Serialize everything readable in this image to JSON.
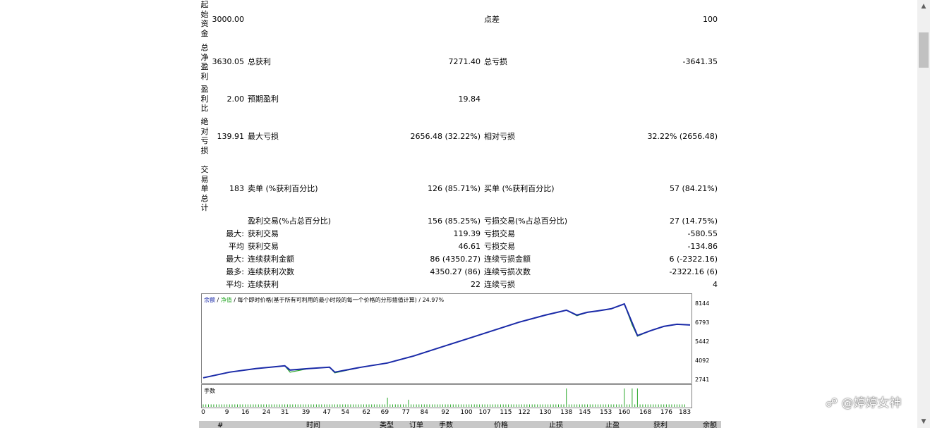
{
  "summary": {
    "initial_deposit_label": "起始资金",
    "initial_deposit": "3000.00",
    "spread_label": "点差",
    "spread": "100",
    "net_profit_label": "总净盈利",
    "net_profit": "3630.05",
    "gross_profit_label": "总获利",
    "gross_profit": "7271.40",
    "gross_loss_label": "总亏损",
    "gross_loss": "-3641.35",
    "profit_factor_label": "盈利比",
    "profit_factor": "2.00",
    "expected_payoff_label": "预期盈利",
    "expected_payoff": "19.84",
    "abs_drawdown_label": "绝对亏损",
    "abs_drawdown": "139.91",
    "max_drawdown_label": "最大亏损",
    "max_drawdown": "2656.48 (32.22%)",
    "rel_drawdown_label": "相对亏损",
    "rel_drawdown": "32.22% (2656.48)",
    "total_trades_label": "交易单总计",
    "total_trades": "183",
    "short_label": "卖单 (%获利百分比)",
    "short_value": "126 (85.71%)",
    "long_label": "买单 (%获利百分比)",
    "long_value": "57 (84.21%)"
  },
  "rows": [
    {
      "prefix": "",
      "label1": "盈利交易(%占总百分比)",
      "value1": "156 (85.25%)",
      "label2": "亏损交易(%占总百分比)",
      "value2": "27 (14.75%)"
    },
    {
      "prefix": "最大:",
      "label1": "获利交易",
      "value1": "119.39",
      "label2": "亏损交易",
      "value2": "-580.55"
    },
    {
      "prefix": "平均",
      "label1": "获利交易",
      "value1": "46.61",
      "label2": "亏损交易",
      "value2": "-134.86"
    },
    {
      "prefix": "最大:",
      "label1": "连续获利金额",
      "value1": "86 (4350.27)",
      "label2": "连续亏损金额",
      "value2": "6 (-2322.16)"
    },
    {
      "prefix": "最多:",
      "label1": "连续获利次数",
      "value1": "4350.27 (86)",
      "label2": "连续亏损次数",
      "value2": "-2322.16 (6)"
    },
    {
      "prefix": "平均:",
      "label1": "连续获利",
      "value1": "22",
      "label2": "连续亏损",
      "value2": "4"
    }
  ],
  "chart": {
    "legend_balance": "余额",
    "legend_sep1": " / ",
    "legend_equity": "净值",
    "legend_rest": " / 每个即时价格(基于所有可利用的最小时段的每一个价格的分形插值计算) / 24.97%",
    "volume_label": "手数",
    "balance_color": "#1a2aa8",
    "equity_color": "#2aa82a",
    "volume_color": "#2aa82a",
    "y_ticks": [
      "8144",
      "6793",
      "5442",
      "4092",
      "2741"
    ],
    "x_ticks": [
      "0",
      "9",
      "16",
      "24",
      "31",
      "39",
      "47",
      "54",
      "62",
      "69",
      "77",
      "84",
      "92",
      "100",
      "107",
      "115",
      "122",
      "130",
      "138",
      "145",
      "153",
      "160",
      "168",
      "176",
      "183"
    ]
  },
  "chart_data": {
    "type": "line",
    "title": "",
    "xlabel": "",
    "ylabel": "",
    "ylim": [
      2741,
      8144
    ],
    "xlim": [
      0,
      185
    ],
    "series": [
      {
        "name": "余额",
        "x": [
          0,
          10,
          20,
          31,
          33,
          40,
          48,
          50,
          60,
          70,
          80,
          90,
          100,
          110,
          120,
          130,
          138,
          142,
          146,
          150,
          155,
          160,
          165,
          170,
          175,
          180,
          185
        ],
        "y": [
          2900,
          3300,
          3550,
          3750,
          3450,
          3550,
          3650,
          3300,
          3650,
          3950,
          4450,
          5050,
          5650,
          6250,
          6850,
          7350,
          7700,
          7350,
          7550,
          7650,
          7800,
          8144,
          5900,
          6250,
          6550,
          6700,
          6650
        ]
      },
      {
        "name": "净值",
        "x": [
          0,
          10,
          20,
          31,
          33,
          40,
          48,
          50,
          60,
          70,
          80,
          90,
          100,
          110,
          120,
          130,
          138,
          142,
          146,
          150,
          155,
          160,
          163,
          165,
          170,
          175,
          180,
          185
        ],
        "y": [
          2900,
          3300,
          3550,
          3750,
          3300,
          3550,
          3650,
          3250,
          3650,
          3950,
          4450,
          5050,
          5650,
          6250,
          6850,
          7350,
          7700,
          7300,
          7550,
          7650,
          7800,
          8144,
          6650,
          5850,
          6250,
          6550,
          6700,
          6650
        ]
      }
    ],
    "volume": {
      "name": "手数",
      "normal": 0.12,
      "spikes": [
        [
          70,
          0.45
        ],
        [
          78,
          0.35
        ],
        [
          138,
          0.9
        ],
        [
          160,
          0.9
        ],
        [
          163,
          0.9
        ],
        [
          165,
          0.9
        ]
      ]
    },
    "x_ticks": [
      0,
      9,
      16,
      24,
      31,
      39,
      47,
      54,
      62,
      69,
      77,
      84,
      92,
      100,
      107,
      115,
      122,
      130,
      138,
      145,
      153,
      160,
      168,
      176,
      183
    ],
    "y_ticks": [
      8144,
      6793,
      5442,
      4092,
      2741
    ],
    "grid": false
  },
  "table_header": [
    "#",
    "时间",
    "类型",
    "订单",
    "手数",
    "价格",
    "止损",
    "止盈",
    "获利",
    "余额"
  ],
  "watermark": "@婷婷女神",
  "watermark_icon": "weibo-like-icon"
}
